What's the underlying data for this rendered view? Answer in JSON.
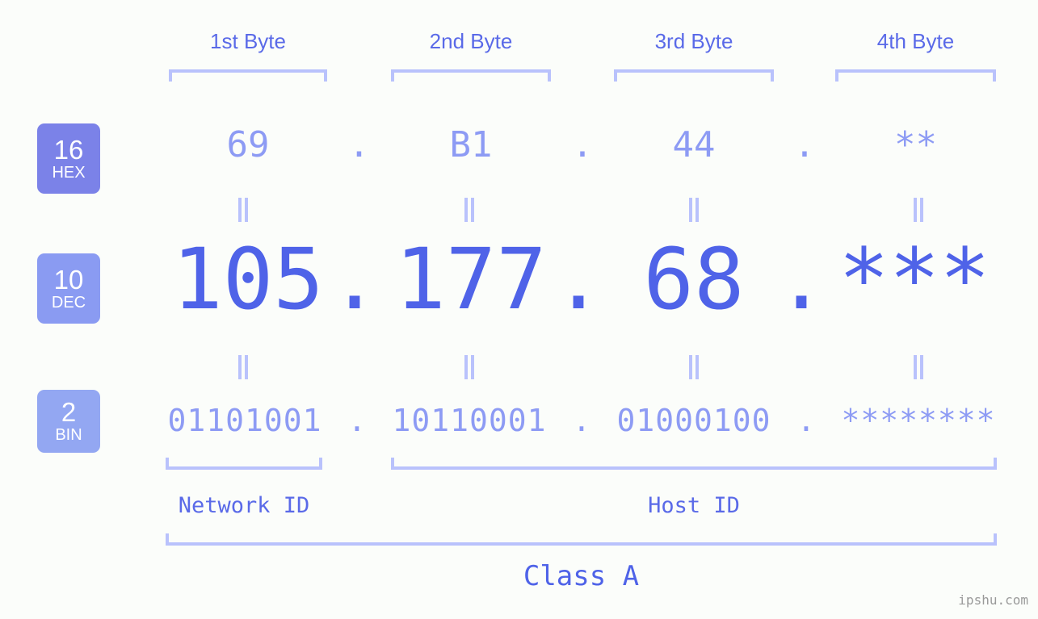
{
  "background_color": "#fbfdfa",
  "accent_colors": {
    "label_blue": "#5a6ae8",
    "light_blue": "#8d9bf4",
    "bracket_blue": "#b9c2fc",
    "dec_blue": "#4f63e8",
    "badge_hex": "#7b82e8",
    "badge_dec": "#8a9bf2",
    "badge_bin": "#93a7f2",
    "watermark_gray": "#9a9a9a"
  },
  "byte_headers": [
    {
      "label": "1st Byte"
    },
    {
      "label": "2nd Byte"
    },
    {
      "label": "3rd Byte"
    },
    {
      "label": "4th Byte"
    }
  ],
  "bases": [
    {
      "number": "16",
      "name": "HEX"
    },
    {
      "number": "10",
      "name": "DEC"
    },
    {
      "number": "2",
      "name": "BIN"
    }
  ],
  "rows": {
    "hex": {
      "values": [
        "69",
        "B1",
        "44",
        "**"
      ],
      "separator": "."
    },
    "dec": {
      "values": [
        "105",
        "177",
        "68",
        "***"
      ],
      "separator": "."
    },
    "bin": {
      "values": [
        "01101001",
        "10110001",
        "01000100",
        "********"
      ],
      "separator": "."
    }
  },
  "equals_marks": {
    "glyph": "=",
    "count": 8
  },
  "regions": {
    "network_id": "Network ID",
    "host_id": "Host ID",
    "class": "Class A"
  },
  "watermark": "ipshu.com"
}
